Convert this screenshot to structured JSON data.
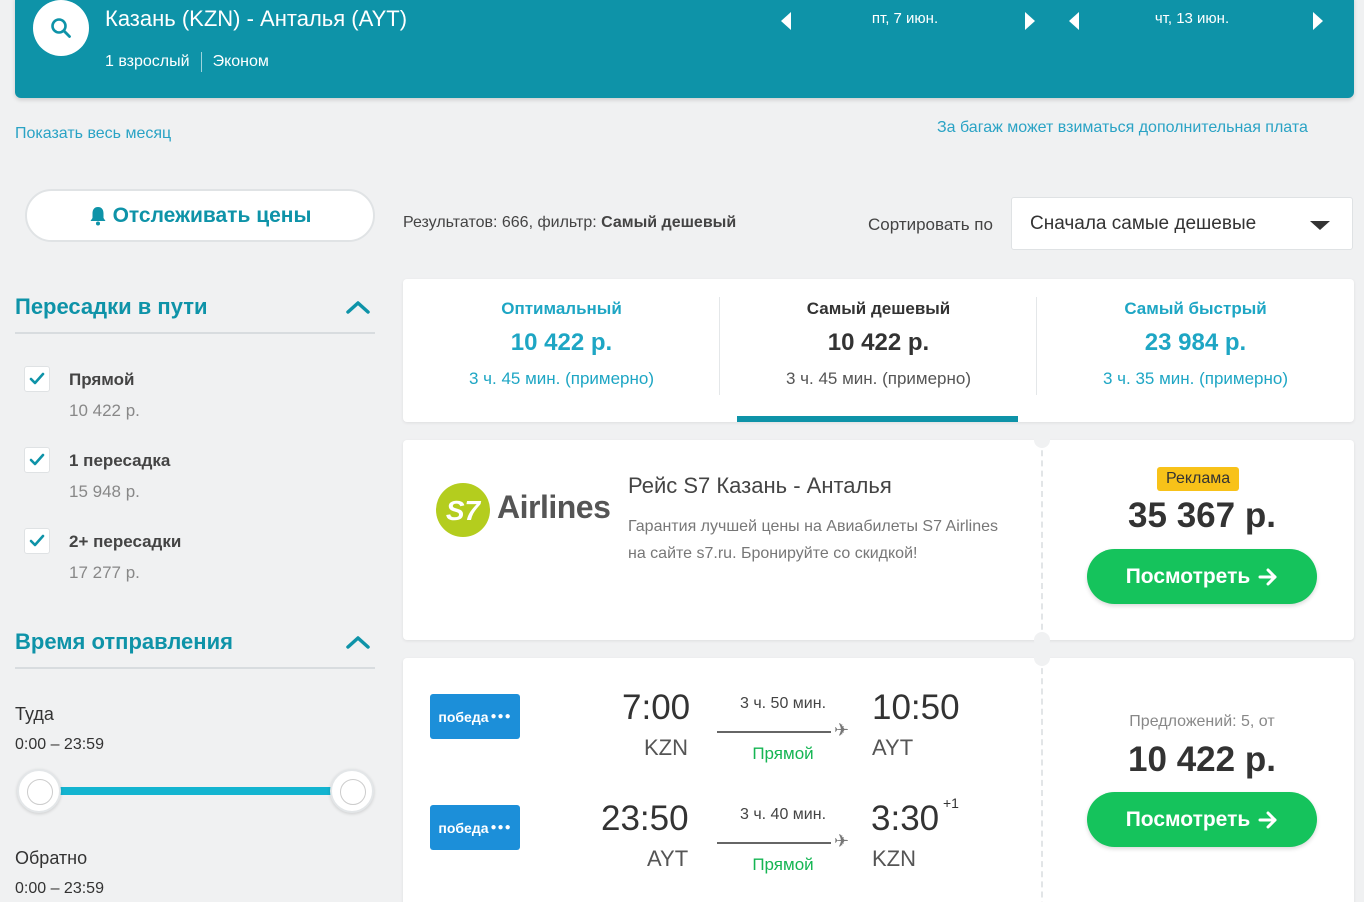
{
  "header": {
    "route": "Казань (KZN) - Анталья (AYT)",
    "passengers": "1 взрослый",
    "class": "Эконом",
    "date_out": "пт, 7 июн.",
    "date_back": "чт, 13 июн."
  },
  "links": {
    "show_month": "Показать весь месяц",
    "baggage_note": "За багаж может взиматься дополнительная плата"
  },
  "track_button": "Отслеживать цены",
  "filters": {
    "stops_title": "Пересадки в пути",
    "stops": [
      {
        "label": "Прямой",
        "price": "10 422 р.",
        "checked": true
      },
      {
        "label": "1 пересадка",
        "price": "15 948 р.",
        "checked": true
      },
      {
        "label": "2+ пересадки",
        "price": "17 277 р.",
        "checked": true
      }
    ],
    "departure_title": "Время отправления",
    "outbound_label": "Туда",
    "outbound_range": "0:00 – 23:59",
    "return_label": "Обратно",
    "return_range": "0:00 – 23:59"
  },
  "results": {
    "prefix": "Результатов: 666, фильтр:",
    "filter": "Самый дешевый",
    "sort_label": "Сортировать по",
    "sort_value": "Сначала самые дешевые"
  },
  "tabs": [
    {
      "title": "Оптимальный",
      "price": "10 422 р.",
      "duration": "3 ч. 45 мин. (примерно)",
      "active": false
    },
    {
      "title": "Самый дешевый",
      "price": "10 422 р.",
      "duration": "3 ч. 45 мин. (примерно)",
      "active": true
    },
    {
      "title": "Самый быстрый",
      "price": "23 984 р.",
      "duration": "3 ч. 35 мин. (примерно)",
      "active": false
    }
  ],
  "ad": {
    "logo_text": "Airlines",
    "logo_mark": "S7",
    "title": "Рейс S7 Казань - Анталья",
    "description": "Гарантия лучшей цены на Авиабилеты S7 Airlines на сайте s7.ru. Бронируйте со скидкой!",
    "badge": "Реклама",
    "price": "35 367 р.",
    "button": "Посмотреть"
  },
  "flight": {
    "airline": "победа",
    "legs": [
      {
        "dep_time": "7:00",
        "dep_code": "KZN",
        "duration": "3 ч. 50 мин.",
        "arr_time": "10:50",
        "arr_code": "AYT",
        "stops": "Прямой",
        "day_offset": ""
      },
      {
        "dep_time": "23:50",
        "dep_code": "AYT",
        "duration": "3 ч. 40 мин.",
        "arr_time": "3:30",
        "arr_code": "KZN",
        "stops": "Прямой",
        "day_offset": "+1"
      }
    ],
    "offers": "Предложений: 5, от",
    "price": "10 422 р.",
    "button": "Посмотреть"
  },
  "colors": {
    "header_bg": "#0e93a8",
    "accent": "#1ea6c4",
    "green_button": "#15c35c",
    "badge": "#f8c219",
    "pobeda": "#1c8fd9",
    "s7_lime": "#b4cd1e"
  }
}
